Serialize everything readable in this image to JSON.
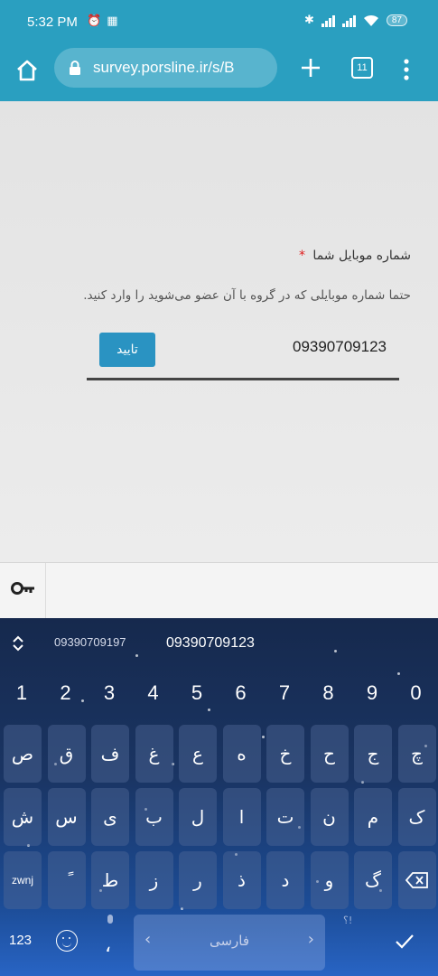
{
  "status_bar": {
    "time": "5:32 PM",
    "battery": "87"
  },
  "browser": {
    "url": "survey.porsline.ir/s/B",
    "tab_count": "11"
  },
  "question": {
    "title": "شماره موبایل شما",
    "required_mark": "*",
    "description": "حتما شماره موبایلی که در گروه با آن عضو می‌شوید را وارد کنید.",
    "answer_value": "09390709123",
    "confirm_label": "تایید"
  },
  "keyboard": {
    "suggestions": [
      "09390709197",
      "09390709123"
    ],
    "numbers": [
      "1",
      "2",
      "3",
      "4",
      "5",
      "6",
      "7",
      "8",
      "9",
      "0"
    ],
    "row1": [
      "ص",
      "ق",
      "ف",
      "غ",
      "ع",
      "ه",
      "خ",
      "ح",
      "ج",
      "چ"
    ],
    "row2": [
      "ش",
      "س",
      "ی",
      "ب",
      "ل",
      "ا",
      "ت",
      "ن",
      "م",
      "ک"
    ],
    "row3": [
      "zwnj",
      "ً",
      "ط",
      "ز",
      "ر",
      "ذ",
      "د",
      "و",
      "گ"
    ],
    "numeric_label": "123",
    "comma_label": "،",
    "space_label": "فارسی",
    "punct_hint": "؟!"
  }
}
